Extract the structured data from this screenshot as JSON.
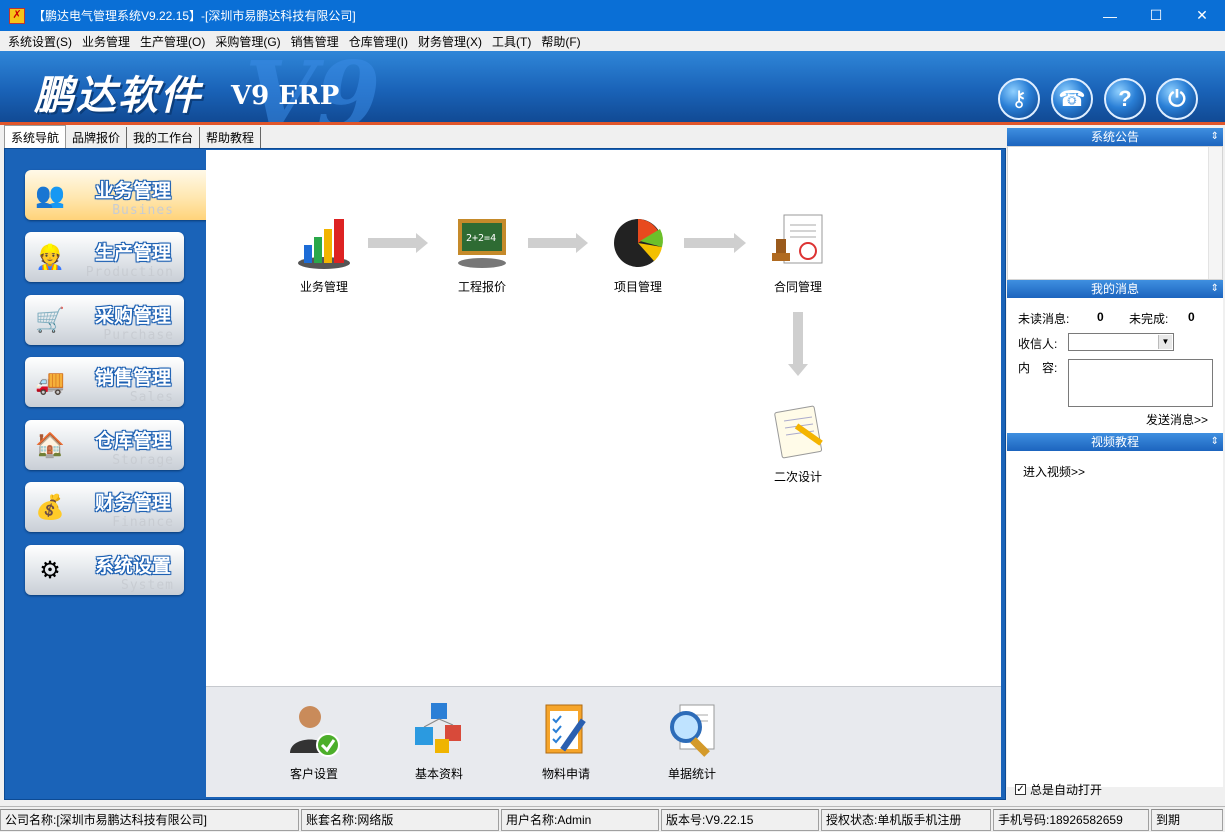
{
  "window": {
    "title": "【鹏达电气管理系统V9.22.15】-[深圳市易鹏达科技有限公司]",
    "minimize": "—",
    "maximize": "☐",
    "close": "✕"
  },
  "menu": [
    "系统设置(S)",
    "业务管理",
    "生产管理(O)",
    "采购管理(G)",
    "销售管理",
    "仓库管理(I)",
    "财务管理(X)",
    "工具(T)",
    "帮助(F)"
  ],
  "banner": {
    "logo": "鹏达软件",
    "v9": "V9",
    "erp": "V9 ERP",
    "buttons": [
      {
        "icon": "key-icon",
        "glyph": "⚷"
      },
      {
        "icon": "support-icon",
        "glyph": "☎"
      },
      {
        "icon": "help-icon",
        "glyph": "?"
      },
      {
        "icon": "power-icon",
        "glyph": "⏻"
      }
    ]
  },
  "tabs": [
    "系统导航",
    "品牌报价",
    "我的工作台",
    "帮助教程"
  ],
  "nav": [
    {
      "cn": "业务管理",
      "en": "Busines",
      "icon": "business-people-icon",
      "glyph": "👥",
      "active": true
    },
    {
      "cn": "生产管理",
      "en": "Production",
      "icon": "worker-icon",
      "glyph": "👷"
    },
    {
      "cn": "采购管理",
      "en": "Purchase",
      "icon": "shopping-cart-icon",
      "glyph": "🛒"
    },
    {
      "cn": "销售管理",
      "en": "Sales",
      "icon": "truck-icon",
      "glyph": "🚚"
    },
    {
      "cn": "仓库管理",
      "en": "Storage",
      "icon": "warehouse-icon",
      "glyph": "🏠"
    },
    {
      "cn": "财务管理",
      "en": "Finance",
      "icon": "money-icon",
      "glyph": "💰"
    },
    {
      "cn": "系统设置",
      "en": "System",
      "icon": "gears-icon",
      "glyph": "⚙"
    }
  ],
  "flow": {
    "business": "业务管理",
    "quote": "工程报价",
    "project": "项目管理",
    "contract": "合同管理",
    "redesign": "二次设计"
  },
  "quick": {
    "customer": "客户设置",
    "basic": "基本资料",
    "material": "物料申请",
    "stats": "单据统计"
  },
  "right": {
    "notice_title": "系统公告",
    "msg_title": "我的消息",
    "unread_label": "未读消息:",
    "unread_value": "0",
    "unfinished_label": "未完成:",
    "unfinished_value": "0",
    "recipient_label": "收信人:",
    "content_label": "内　容:",
    "send": "发送消息>>",
    "video_title": "视频教程",
    "video_link": "进入视频>>",
    "auto_open": "总是自动打开",
    "auto_open_checked": "✓",
    "collapse_glyph": "⇕"
  },
  "status": {
    "company": "公司名称:[深圳市易鹏达科技有限公司]",
    "account": "账套名称:网络版",
    "user": "用户名称:Admin",
    "version": "版本号:V9.22.15",
    "license": "授权状态:单机版手机注册",
    "phone": "手机号码:18926582659",
    "expire": "到期"
  }
}
